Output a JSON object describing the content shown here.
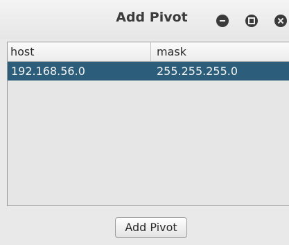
{
  "window": {
    "title": "Add Pivot",
    "controls": [
      "minimize-icon",
      "maximize-icon",
      "close-icon"
    ]
  },
  "table": {
    "columns": [
      "host",
      "mask"
    ],
    "rows": [
      {
        "host": "192.168.56.0",
        "mask": "255.255.255.0",
        "selected": true
      }
    ]
  },
  "actions": {
    "add_label": "Add Pivot"
  },
  "colors": {
    "selected_row": "#2c5e7b",
    "window_bg": "#e9e9e9"
  }
}
